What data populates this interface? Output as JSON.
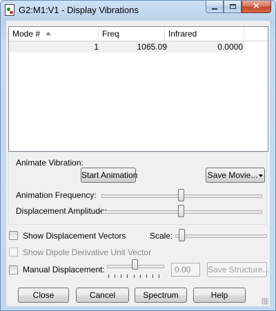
{
  "window": {
    "title": "G2:M1:V1 - Display Vibrations"
  },
  "table": {
    "columns": [
      "Mode #",
      "Freq",
      "Infrared"
    ],
    "rows": [
      {
        "mode": "1",
        "freq": "1065.09",
        "infrared": "0.0000"
      }
    ]
  },
  "animate": {
    "group_label": "Animate Vibration:",
    "start_button": "Start Animation",
    "save_movie_button": "Save Movie...",
    "frequency_label": "Animation Frequency:",
    "frequency_level": 0.5,
    "amplitude_label": "Displacement Amplitude:",
    "amplitude_level": 0.5
  },
  "options": {
    "show_displacement_vectors": {
      "label": "Show Displacement Vectors",
      "checked": false
    },
    "scale_label": "Scale:",
    "scale_level": 0.0,
    "show_dipole": {
      "label": "Show Dipole Derivative Unit Vector",
      "checked": false,
      "enabled": false
    },
    "manual_displacement": {
      "label": "Manual Displacement:",
      "checked": false
    },
    "manual_level": 0.5,
    "manual_value": "0.00",
    "save_structure_button": "Save Structure..."
  },
  "footer": {
    "close": "Close",
    "cancel": "Cancel",
    "spectrum": "Spectrum",
    "help": "Help"
  },
  "icons": {
    "app": "molecule-document-icon",
    "minimize": "minimize-icon",
    "maximize": "maximize-icon",
    "close": "close-icon",
    "sort": "sort-ascending-icon"
  },
  "colors": {
    "titlebar": "#b9d1ea",
    "close_button": "#c3432a",
    "selected_row": "#f0f0f0"
  }
}
